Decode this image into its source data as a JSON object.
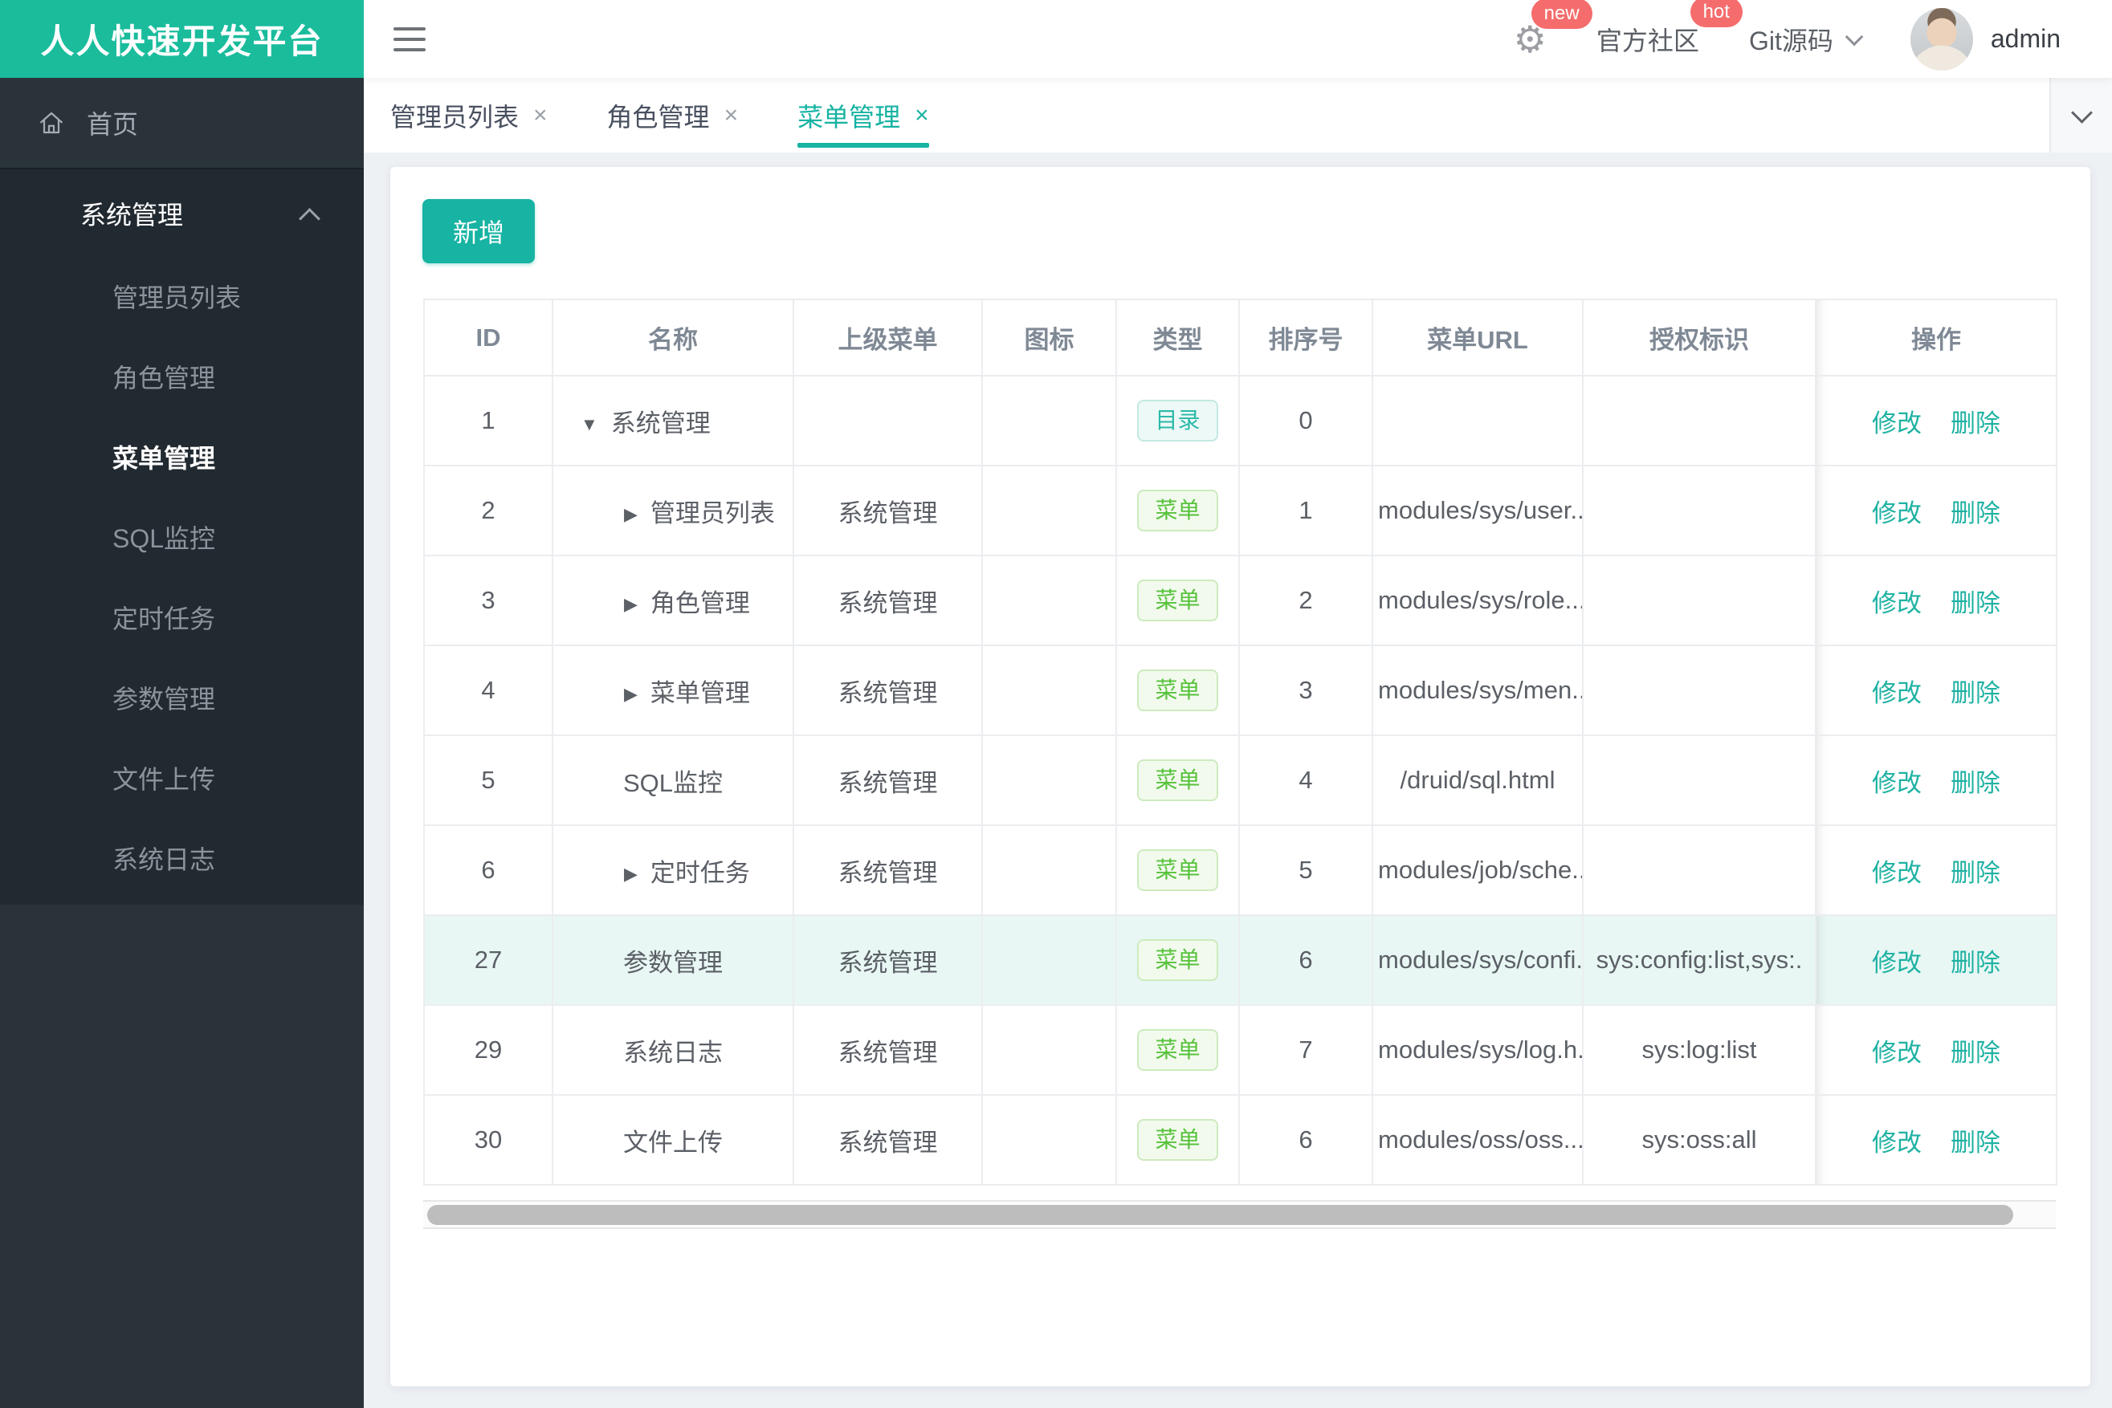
{
  "app": {
    "title": "人人快速开发平台"
  },
  "header": {
    "badge_new": "new",
    "community": "官方社区",
    "badge_hot": "hot",
    "git": "Git源码",
    "user": "admin"
  },
  "sidebar": {
    "home": "首页",
    "section": "系统管理",
    "items": [
      {
        "label": "管理员列表"
      },
      {
        "label": "角色管理"
      },
      {
        "label": "菜单管理"
      },
      {
        "label": "SQL监控"
      },
      {
        "label": "定时任务"
      },
      {
        "label": "参数管理"
      },
      {
        "label": "文件上传"
      },
      {
        "label": "系统日志"
      }
    ]
  },
  "tabs": [
    {
      "label": "管理员列表"
    },
    {
      "label": "角色管理"
    },
    {
      "label": "菜单管理"
    }
  ],
  "toolbar": {
    "add_label": "新增"
  },
  "table": {
    "columns": [
      "ID",
      "名称",
      "上级菜单",
      "图标",
      "类型",
      "排序号",
      "菜单URL",
      "授权标识",
      "操作"
    ],
    "ops": {
      "edit": "修改",
      "del": "删除"
    },
    "rows": [
      {
        "id": "1",
        "name": "系统管理",
        "parent": "",
        "icon": "",
        "type_label": "目录",
        "order": "0",
        "url": "",
        "perms": ""
      },
      {
        "id": "2",
        "name": "管理员列表",
        "parent": "系统管理",
        "icon": "",
        "type_label": "菜单",
        "order": "1",
        "url": "modules/sys/user....",
        "perms": ""
      },
      {
        "id": "3",
        "name": "角色管理",
        "parent": "系统管理",
        "icon": "",
        "type_label": "菜单",
        "order": "2",
        "url": "modules/sys/role....",
        "perms": ""
      },
      {
        "id": "4",
        "name": "菜单管理",
        "parent": "系统管理",
        "icon": "",
        "type_label": "菜单",
        "order": "3",
        "url": "modules/sys/men...",
        "perms": ""
      },
      {
        "id": "5",
        "name": "SQL监控",
        "parent": "系统管理",
        "icon": "",
        "type_label": "菜单",
        "order": "4",
        "url": "/druid/sql.html",
        "perms": ""
      },
      {
        "id": "6",
        "name": "定时任务",
        "parent": "系统管理",
        "icon": "",
        "type_label": "菜单",
        "order": "5",
        "url": "modules/job/sche...",
        "perms": ""
      },
      {
        "id": "27",
        "name": "参数管理",
        "parent": "系统管理",
        "icon": "",
        "type_label": "菜单",
        "order": "6",
        "url": "modules/sys/confi...",
        "perms": "sys:config:list,sys:."
      },
      {
        "id": "29",
        "name": "系统日志",
        "parent": "系统管理",
        "icon": "",
        "type_label": "菜单",
        "order": "7",
        "url": "modules/sys/log.h...",
        "perms": "sys:log:list"
      },
      {
        "id": "30",
        "name": "文件上传",
        "parent": "系统管理",
        "icon": "",
        "type_label": "菜单",
        "order": "6",
        "url": "modules/oss/oss....",
        "perms": "sys:oss:all"
      }
    ]
  },
  "colors": {
    "brand": "#1ABC9C",
    "accent": "#17B3A3",
    "badge_red": "#F56C6C",
    "menu_green": "#57C23C",
    "sidebar_bg": "#2A333A",
    "highlight_row": "#E8F7F4"
  }
}
